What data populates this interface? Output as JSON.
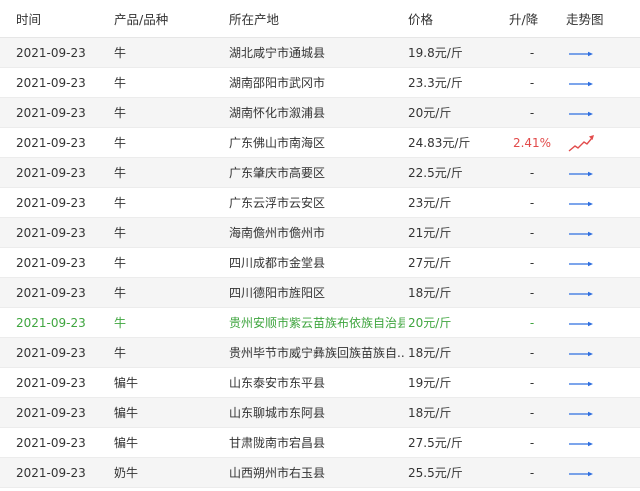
{
  "headers": {
    "time": "时间",
    "product": "产品/品种",
    "origin": "所在产地",
    "price": "价格",
    "change": "升/降",
    "trend": "走势图"
  },
  "colors": {
    "flat_arrow": "#2f6fe0",
    "up_arrow": "#e24b4b",
    "up_text": "#e24b4b",
    "highlight_text": "#3fa53f",
    "stripe": "#f5f5f5"
  },
  "rows": [
    {
      "time": "2021-09-23",
      "product": "牛",
      "origin": "湖北咸宁市通城县",
      "price": "19.8元/斤",
      "change": "-",
      "trend": "flat-arrow-icon"
    },
    {
      "time": "2021-09-23",
      "product": "牛",
      "origin": "湖南邵阳市武冈市",
      "price": "23.3元/斤",
      "change": "-",
      "trend": "flat-arrow-icon"
    },
    {
      "time": "2021-09-23",
      "product": "牛",
      "origin": "湖南怀化市溆浦县",
      "price": "20元/斤",
      "change": "-",
      "trend": "flat-arrow-icon"
    },
    {
      "time": "2021-09-23",
      "product": "牛",
      "origin": "广东佛山市南海区",
      "price": "24.83元/斤",
      "change": "2.41%",
      "trend": "up-trend-icon"
    },
    {
      "time": "2021-09-23",
      "product": "牛",
      "origin": "广东肇庆市高要区",
      "price": "22.5元/斤",
      "change": "-",
      "trend": "flat-arrow-icon"
    },
    {
      "time": "2021-09-23",
      "product": "牛",
      "origin": "广东云浮市云安区",
      "price": "23元/斤",
      "change": "-",
      "trend": "flat-arrow-icon"
    },
    {
      "time": "2021-09-23",
      "product": "牛",
      "origin": "海南儋州市儋州市",
      "price": "21元/斤",
      "change": "-",
      "trend": "flat-arrow-icon"
    },
    {
      "time": "2021-09-23",
      "product": "牛",
      "origin": "四川成都市金堂县",
      "price": "27元/斤",
      "change": "-",
      "trend": "flat-arrow-icon"
    },
    {
      "time": "2021-09-23",
      "product": "牛",
      "origin": "四川德阳市旌阳区",
      "price": "18元/斤",
      "change": "-",
      "trend": "flat-arrow-icon"
    },
    {
      "time": "2021-09-23",
      "product": "牛",
      "origin": "贵州安顺市紫云苗族布依族自治县",
      "price": "20元/斤",
      "change": "-",
      "trend": "flat-arrow-icon",
      "highlight": true
    },
    {
      "time": "2021-09-23",
      "product": "牛",
      "origin": "贵州毕节市威宁彝族回族苗族自...",
      "price": "18元/斤",
      "change": "-",
      "trend": "flat-arrow-icon"
    },
    {
      "time": "2021-09-23",
      "product": "犏牛",
      "origin": "山东泰安市东平县",
      "price": "19元/斤",
      "change": "-",
      "trend": "flat-arrow-icon"
    },
    {
      "time": "2021-09-23",
      "product": "犏牛",
      "origin": "山东聊城市东阿县",
      "price": "18元/斤",
      "change": "-",
      "trend": "flat-arrow-icon"
    },
    {
      "time": "2021-09-23",
      "product": "犏牛",
      "origin": "甘肃陇南市宕昌县",
      "price": "27.5元/斤",
      "change": "-",
      "trend": "flat-arrow-icon"
    },
    {
      "time": "2021-09-23",
      "product": "奶牛",
      "origin": "山西朔州市右玉县",
      "price": "25.5元/斤",
      "change": "-",
      "trend": "flat-arrow-icon"
    }
  ]
}
